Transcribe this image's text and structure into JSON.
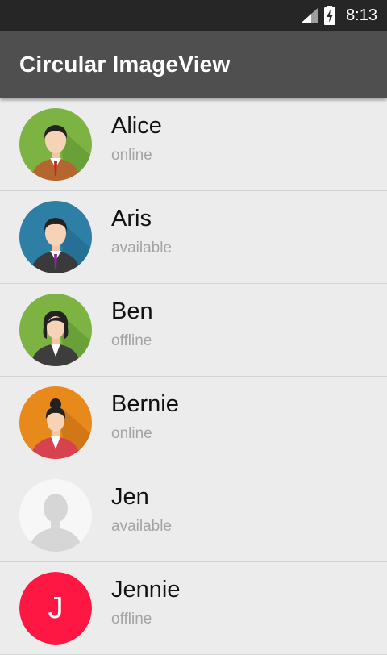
{
  "status_bar": {
    "time": "8:13"
  },
  "app_bar": {
    "title": "Circular ImageView"
  },
  "contacts": [
    {
      "name": "Alice",
      "status": "online"
    },
    {
      "name": "Aris",
      "status": "available"
    },
    {
      "name": "Ben",
      "status": "offline"
    },
    {
      "name": "Bernie",
      "status": "online"
    },
    {
      "name": "Jen",
      "status": "available"
    },
    {
      "name": "Jennie",
      "status": "offline",
      "initial": "J"
    }
  ],
  "colors": {
    "status_bar": "#262626",
    "app_bar": "#4f4f4f",
    "list_bg": "#ececec",
    "avatar_alice": "#7cb342",
    "avatar_aris": "#2e7fa6",
    "avatar_ben": "#7cb342",
    "avatar_bernie": "#e8891c",
    "avatar_jennie": "#ff1744"
  }
}
